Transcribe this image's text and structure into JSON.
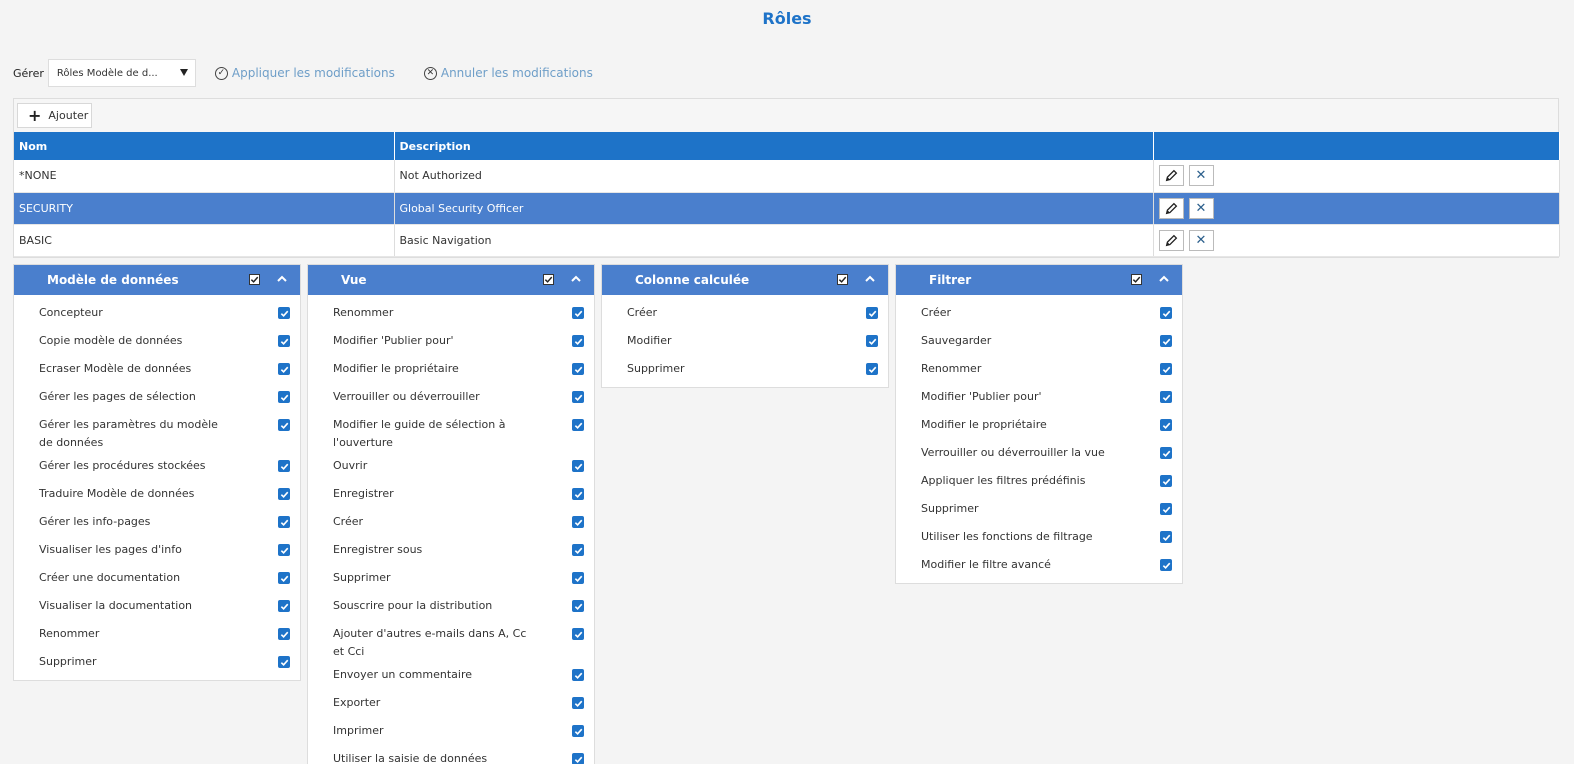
{
  "page": {
    "title": "Rôles"
  },
  "toolbar": {
    "manage_label": "Gérer",
    "manage_select_value": "Rôles Modèle de d...",
    "apply_label": "Appliquer les modifications",
    "cancel_label": "Annuler les modifications"
  },
  "grid": {
    "add_label": "Ajouter",
    "columns": [
      "Nom",
      "Description",
      ""
    ],
    "rows": [
      {
        "name": "*NONE",
        "description": "Not Authorized"
      },
      {
        "name": "SECURITY",
        "description": "Global Security Officer"
      },
      {
        "name": "BASIC",
        "description": "Basic Navigation"
      }
    ]
  },
  "panels": [
    {
      "title": "Modèle de données",
      "items": [
        "Concepteur",
        "Copie modèle de données",
        "Ecraser Modèle de données",
        "Gérer les pages de sélection",
        "Gérer les paramètres du modèle de données",
        "Gérer les procédures stockées",
        "Traduire Modèle de données",
        "Gérer les info-pages",
        "Visualiser les pages d'info",
        "Créer une documentation",
        "Visualiser la documentation",
        "Renommer",
        "Supprimer"
      ]
    },
    {
      "title": "Vue",
      "items": [
        "Renommer",
        "Modifier 'Publier pour'",
        "Modifier le propriétaire",
        "Verrouiller ou déverrouiller",
        "Modifier le guide de sélection à l'ouverture",
        "Ouvrir",
        "Enregistrer",
        "Créer",
        "Enregistrer sous",
        "Supprimer",
        "Souscrire pour la distribution",
        "Ajouter d'autres e-mails dans A, Cc et Cci",
        "Envoyer un commentaire",
        "Exporter",
        "Imprimer",
        "Utiliser la saisie de données"
      ]
    },
    {
      "title": "Colonne calculée",
      "items": [
        "Créer",
        "Modifier",
        "Supprimer"
      ]
    },
    {
      "title": "Filtrer",
      "items": [
        "Créer",
        "Sauvegarder",
        "Renommer",
        "Modifier 'Publier pour'",
        "Modifier le propriétaire",
        "Verrouiller ou déverrouiller la vue",
        "Appliquer les filtres prédéfinis",
        "Supprimer",
        "Utiliser les fonctions de filtrage",
        "Modifier le filtre avancé"
      ]
    }
  ],
  "colors": {
    "accent": "#1e73c8",
    "selected_row": "#4a7fcd",
    "link": "#6e9ec8"
  }
}
